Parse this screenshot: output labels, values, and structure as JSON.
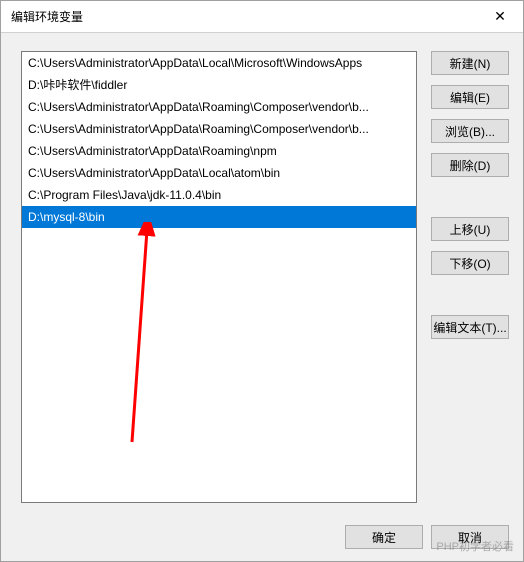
{
  "titlebar": {
    "title": "编辑环境变量"
  },
  "list": {
    "items": [
      "C:\\Users\\Administrator\\AppData\\Local\\Microsoft\\WindowsApps",
      "D:\\咔咔软件\\fiddler",
      "C:\\Users\\Administrator\\AppData\\Roaming\\Composer\\vendor\\b...",
      "C:\\Users\\Administrator\\AppData\\Roaming\\Composer\\vendor\\b...",
      "C:\\Users\\Administrator\\AppData\\Roaming\\npm",
      "C:\\Users\\Administrator\\AppData\\Local\\atom\\bin",
      "C:\\Program Files\\Java\\jdk-11.0.4\\bin",
      "D:\\mysql-8\\bin"
    ],
    "selected_index": 7
  },
  "buttons": {
    "new": "新建(N)",
    "edit": "编辑(E)",
    "browse": "浏览(B)...",
    "delete": "删除(D)",
    "move_up": "上移(U)",
    "move_down": "下移(O)",
    "edit_text": "编辑文本(T)...",
    "ok": "确定",
    "cancel": "取消"
  },
  "watermark": "PHP初学者必看"
}
